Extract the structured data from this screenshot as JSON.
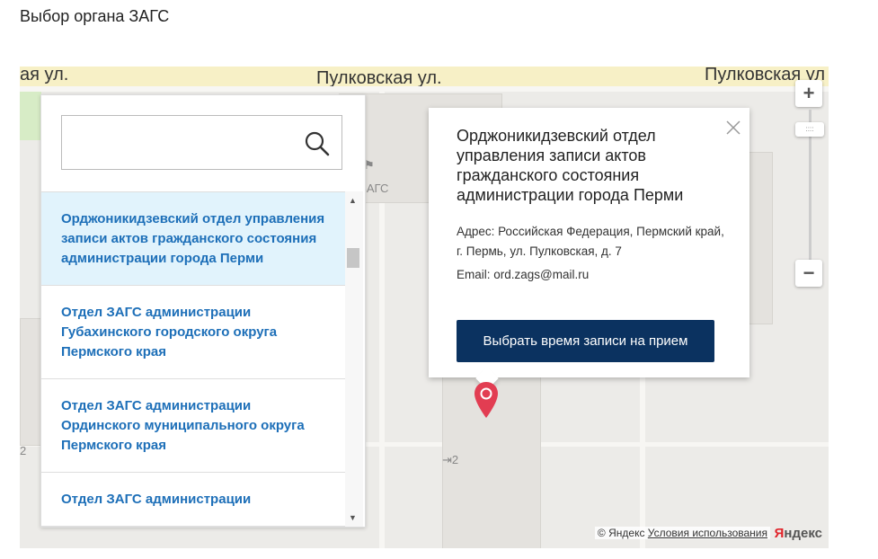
{
  "page": {
    "title": "Выбор органа ЗАГС"
  },
  "map": {
    "street_left": "ая ул.",
    "street_center": "Пулковская ул.",
    "street_right": "Пулковская ул",
    "poi_label": "ЗАГС",
    "house_number": "2",
    "house_number_left": "2",
    "copyright_prefix": "© Яндекс",
    "terms_link": "Условия использования",
    "logo_first": "Я",
    "logo_rest": "ндекс"
  },
  "search": {
    "placeholder": "",
    "value": ""
  },
  "list": {
    "items": [
      {
        "label": "Орджоникидзевский отдел управления записи актов гражданского состояния администрации города Перми",
        "active": true
      },
      {
        "label": "Отдел ЗАГС администрации Губахинского городского округа Пермского края",
        "active": false
      },
      {
        "label": "Отдел ЗАГС администрации Ординского муниципального округа Пермского края",
        "active": false
      },
      {
        "label": "Отдел ЗАГС администрации",
        "active": false
      }
    ]
  },
  "popup": {
    "title": "Орджоникидзевский отдел управления записи актов гражданского состояния администрации города Перми",
    "address": "Адрес: Российская Федерация, Пермский край, г. Пермь, ул. Пулковская, д. 7",
    "email": "Email: ord.zags@mail.ru",
    "button_label": "Выбрать время записи на прием"
  },
  "zoom": {
    "plus": "+",
    "minus": "−"
  },
  "colors": {
    "link": "#1d6fb8",
    "active_bg": "#e1f3fc",
    "button_bg": "#0b3260",
    "marker": "#e23d52"
  }
}
